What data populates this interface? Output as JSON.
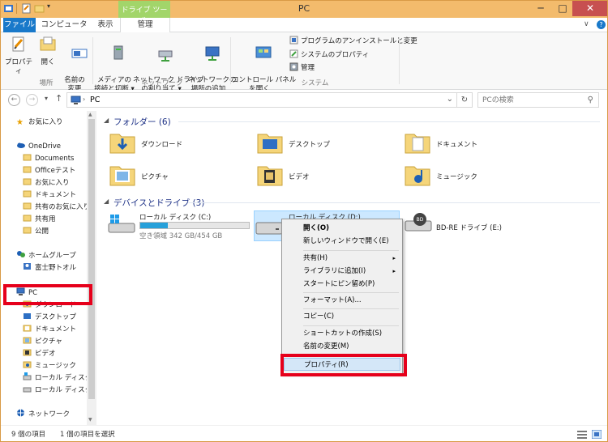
{
  "window": {
    "title": "PC",
    "context_tab_group": "ドライブ ツール",
    "minimize": "─",
    "maximize": "□",
    "close": "✕"
  },
  "ribbon": {
    "tabs": [
      "ファイル",
      "コンピューター",
      "表示",
      "管理"
    ],
    "right_controls": [
      "∨",
      "?"
    ],
    "location_group": {
      "label": "場所",
      "buttons": [
        "プロパティ",
        "開く",
        "名前の\n変更"
      ]
    },
    "network_group": {
      "label": "ネットワーク",
      "buttons": [
        "メディアの\n接続と切断 ▾",
        "ネットワーク ドライブ\nの割り当て ▾",
        "ネットワークの\n場所の追加"
      ]
    },
    "system_group": {
      "label": "システム",
      "big_button": "コントロール パネル\nを開く",
      "small_buttons": [
        "プログラムのアンインストールと変更",
        "システムのプロパティ",
        "管理"
      ]
    }
  },
  "address": {
    "back": "←",
    "forward": "→",
    "recent": "▾",
    "up": "↑",
    "path": "PC",
    "dropdown": "⌄",
    "refresh": "↻",
    "search_placeholder": "PCの検索",
    "search_icon": "⚲"
  },
  "navigation": {
    "favorites": "お気に入り",
    "onedrive": "OneDrive",
    "onedrive_items": [
      "Documents",
      "Officeテスト",
      "お気に入り",
      "ドキュメント",
      "共有のお気に入り",
      "共有用",
      "公開"
    ],
    "homegroup": "ホームグループ",
    "homegroup_user": "富士野トオル",
    "pc": "PC",
    "pc_items": [
      "ダウンロード",
      "デスクトップ",
      "ドキュメント",
      "ピクチャ",
      "ビデオ",
      "ミュージック",
      "ローカル ディスク (C",
      "ローカル ディスク (D"
    ],
    "network": "ネットワーク",
    "scroll_up": "▲",
    "scroll_down": "▼"
  },
  "content": {
    "folders_header": "フォルダー (6)",
    "folders": [
      "ダウンロード",
      "デスクトップ",
      "ドキュメント",
      "ピクチャ",
      "ビデオ",
      "ミュージック"
    ],
    "devices_header": "デバイスとドライブ (3)",
    "drives": [
      {
        "name": "ローカル ディスク (C:)",
        "free": "空き領域 342 GB/454 GB",
        "used_fraction": 0.25
      },
      {
        "name": "ローカル ディスク (D:)",
        "free": "",
        "used_fraction": 0
      },
      {
        "name": "BD-RE ドライブ (E:)",
        "free": "",
        "used_fraction": 0
      }
    ]
  },
  "context_menu": {
    "items": [
      {
        "label": "開く(O)",
        "bold": true
      },
      {
        "label": "新しいウィンドウで開く(E)"
      },
      {
        "label": "共有(H)",
        "submenu": "▸"
      },
      {
        "label": "ライブラリに追加(I)",
        "submenu": "▸"
      },
      {
        "label": "スタートにピン留め(P)"
      },
      {
        "label": "フォーマット(A)..."
      },
      {
        "label": "コピー(C)"
      },
      {
        "label": "ショートカットの作成(S)"
      },
      {
        "label": "名前の変更(M)"
      },
      {
        "label": "プロパティ(R)"
      }
    ]
  },
  "status": {
    "item_count": "9 個の項目",
    "selected": "1 個の項目を選択"
  },
  "colors": {
    "title_bar": "#f3bb6c",
    "file_tab": "#1979ca",
    "context_tab": "#a2d56a",
    "highlight_red": "#e6001b",
    "selection": "#cce8ff",
    "progress": "#26a0da"
  }
}
